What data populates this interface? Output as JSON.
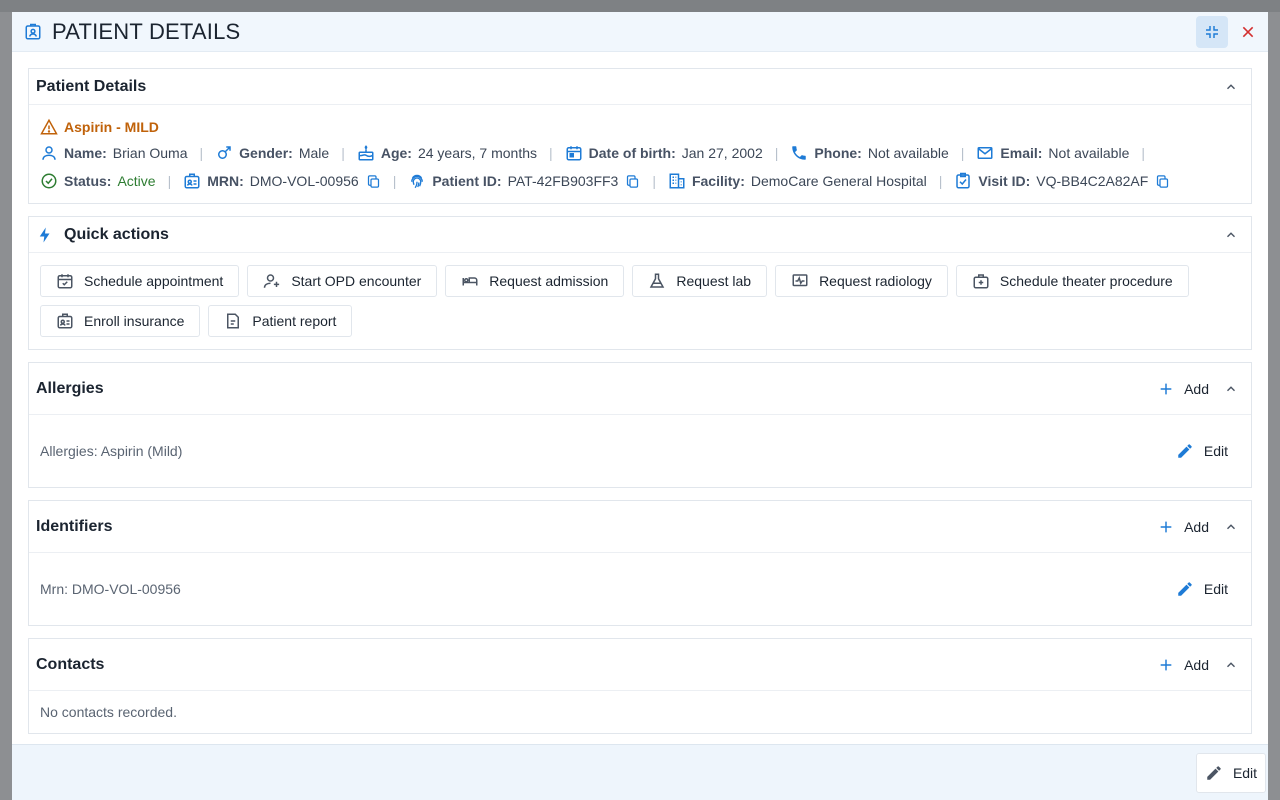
{
  "modal": {
    "title": "PATIENT DETAILS",
    "collapse_label": "collapse",
    "close_label": "close"
  },
  "patient_details": {
    "section_title": "Patient Details",
    "allergy_alert": "Aspirin - MILD",
    "name_label": "Name:",
    "name": "Brian Ouma",
    "gender_label": "Gender:",
    "gender": "Male",
    "age_label": "Age:",
    "age": "24 years, 7 months",
    "dob_label": "Date of birth:",
    "dob": "Jan 27, 2002",
    "phone_label": "Phone:",
    "phone": "Not available",
    "email_label": "Email:",
    "email": "Not available",
    "status_label": "Status:",
    "status": "Active",
    "mrn_label": "MRN:",
    "mrn": "DMO-VOL-00956",
    "patient_id_label": "Patient ID:",
    "patient_id": "PAT-42FB903FF3",
    "facility_label": "Facility:",
    "facility": "DemoCare General Hospital",
    "visit_id_label": "Visit ID:",
    "visit_id": "VQ-BB4C2A82AF",
    "separator": "|",
    "status_color": "#2e7d32",
    "alert_color": "#c0620a"
  },
  "quick_actions": {
    "section_title": "Quick actions",
    "buttons": [
      {
        "label": "Schedule appointment",
        "icon": "calendar-check-icon"
      },
      {
        "label": "Start OPD encounter",
        "icon": "person-add-icon"
      },
      {
        "label": "Request admission",
        "icon": "bed-icon"
      },
      {
        "label": "Request lab",
        "icon": "flask-icon"
      },
      {
        "label": "Request radiology",
        "icon": "monitor-pulse-icon"
      },
      {
        "label": "Schedule theater procedure",
        "icon": "medical-bag-icon"
      },
      {
        "label": "Enroll insurance",
        "icon": "id-card-icon"
      },
      {
        "label": "Patient report",
        "icon": "document-icon"
      }
    ]
  },
  "allergies": {
    "section_title": "Allergies",
    "add_label": "Add",
    "content": "Allergies: Aspirin (Mild)",
    "edit_label": "Edit"
  },
  "identifiers": {
    "section_title": "Identifiers",
    "add_label": "Add",
    "content": "Mrn: DMO-VOL-00956",
    "edit_label": "Edit"
  },
  "contacts": {
    "section_title": "Contacts",
    "add_label": "Add",
    "content": "No contacts recorded."
  },
  "footer": {
    "edit_label": "Edit"
  },
  "colors": {
    "accent": "#1e7bd6",
    "close": "#d32f2f"
  }
}
